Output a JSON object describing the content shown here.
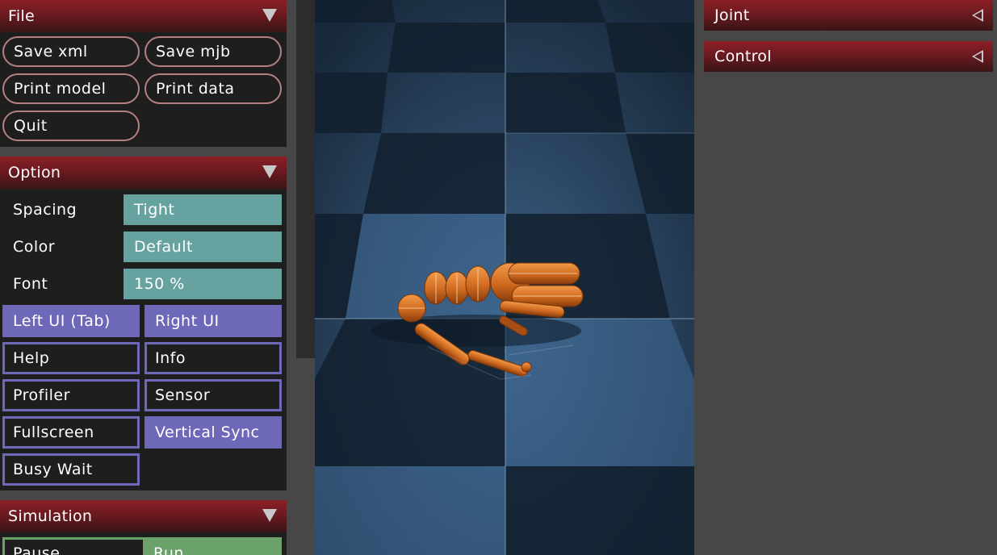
{
  "left_ui": {
    "file": {
      "title": "File",
      "buttons": [
        "Save xml",
        "Save mjb",
        "Print model",
        "Print data",
        "Quit"
      ]
    },
    "option": {
      "title": "Option",
      "spacing": {
        "label": "Spacing",
        "value": "Tight"
      },
      "color": {
        "label": "Color",
        "value": "Default"
      },
      "font": {
        "label": "Font",
        "value": "150 %"
      },
      "checks": [
        {
          "label": "Left UI (Tab)",
          "on": true
        },
        {
          "label": "Right UI",
          "on": true
        },
        {
          "label": "Help",
          "on": false
        },
        {
          "label": "Info",
          "on": false
        },
        {
          "label": "Profiler",
          "on": false
        },
        {
          "label": "Sensor",
          "on": false
        },
        {
          "label": "Fullscreen",
          "on": false
        },
        {
          "label": "Vertical Sync",
          "on": true
        },
        {
          "label": "Busy Wait",
          "on": false
        }
      ]
    },
    "simulation": {
      "title": "Simulation",
      "radio": [
        {
          "label": "Pause",
          "on": false
        },
        {
          "label": "Run",
          "on": true
        }
      ]
    }
  },
  "right_ui": {
    "joint": {
      "title": "Joint"
    },
    "control": {
      "title": "Control"
    }
  },
  "colors": {
    "header_red": "#8c1f26",
    "select_teal": "#66a3a0",
    "check_purple": "#6e68b8",
    "radio_green": "#6aa26a",
    "button_border": "#b58080",
    "body_orange": "#d2691e"
  },
  "icons": {
    "collapse": "triangle-down-icon",
    "expand": "triangle-left-icon"
  }
}
